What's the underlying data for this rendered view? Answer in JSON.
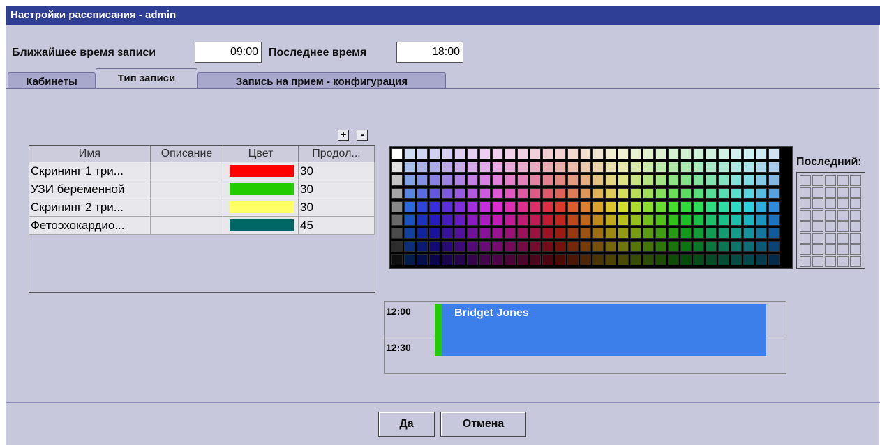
{
  "window": {
    "title": "Настройки рассписания - admin"
  },
  "header": {
    "earliest_label": "Ближайшее время записи",
    "earliest_value": "09:00",
    "latest_label": "Последнее время",
    "latest_value": "18:00"
  },
  "tabs": [
    {
      "label": "Кабинеты",
      "active": false
    },
    {
      "label": "Тип записи",
      "active": true
    },
    {
      "label": "Запись на прием - конфигурация",
      "active": false
    }
  ],
  "table_controls": {
    "add": "+",
    "remove": "-"
  },
  "table": {
    "columns": [
      "Имя",
      "Описание",
      "Цвет",
      "Продол..."
    ],
    "rows": [
      {
        "name": "Скрининг 1 три...",
        "description": "",
        "color": "#ff0000",
        "duration": "30"
      },
      {
        "name": "УЗИ беременной",
        "description": "",
        "color": "#22cc00",
        "duration": "30"
      },
      {
        "name": "Скрининг 2 три...",
        "description": "",
        "color": "#ffff66",
        "duration": "30"
      },
      {
        "name": "Фетоэхокардио...",
        "description": "",
        "color": "#006666",
        "duration": "45"
      }
    ]
  },
  "palette": {
    "recent_label": "Последний:"
  },
  "preview": {
    "time_1": "12:00",
    "time_2": "12:30",
    "appointment_name": "Bridget Jones",
    "appointment_color": "#3c7eea",
    "type_color": "#22cc00"
  },
  "footer": {
    "ok_label": "Да",
    "cancel_label": "Отмена"
  }
}
